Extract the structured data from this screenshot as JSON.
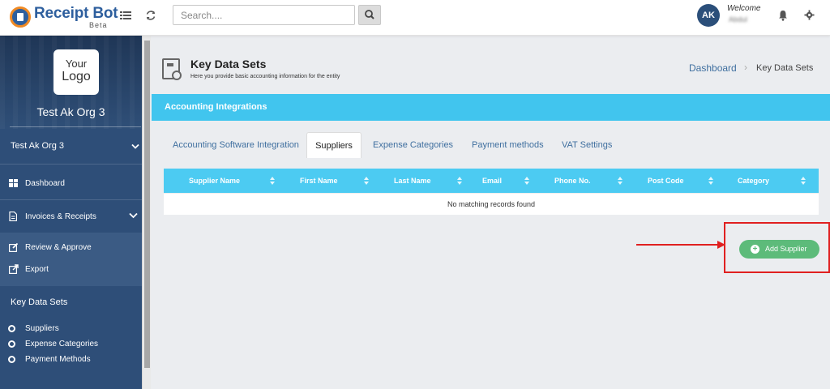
{
  "app": {
    "brand_name": "Receipt Bot",
    "brand_sub": "Beta"
  },
  "header": {
    "search_placeholder": "Search....",
    "avatar_initials": "AK",
    "welcome_label": "Welcome",
    "username": "Abdul"
  },
  "sidebar": {
    "logo_line1": "Your",
    "logo_line2": "Logo",
    "org_title": "Test Ak Org 3",
    "org_selector": "Test Ak Org 3",
    "items": [
      {
        "label": "Dashboard",
        "icon": "dashboard-icon"
      },
      {
        "label": "Invoices & Receipts",
        "icon": "document-icon"
      },
      {
        "label": "Review & Approve",
        "icon": "edit-icon"
      },
      {
        "label": "Export",
        "icon": "export-icon"
      }
    ],
    "section_title": "Key Data Sets",
    "section_items": [
      "Suppliers",
      "Expense Categories",
      "Payment Methods"
    ]
  },
  "page": {
    "title": "Key Data Sets",
    "subtitle": "Here you provide basic accounting information for the entity",
    "breadcrumb": {
      "home": "Dashboard",
      "sep": "›",
      "current": "Key Data Sets"
    }
  },
  "panel": {
    "title": "Accounting Integrations",
    "tabs": [
      {
        "label": "Accounting Software Integration",
        "active": false
      },
      {
        "label": "Suppliers",
        "active": true
      },
      {
        "label": "Expense Categories",
        "active": false
      },
      {
        "label": "Payment methods",
        "active": false
      },
      {
        "label": "VAT Settings",
        "active": false
      }
    ]
  },
  "table": {
    "columns": [
      "Supplier Name",
      "First Name",
      "Last Name",
      "Email",
      "Phone No.",
      "Post Code",
      "Category"
    ],
    "empty_message": "No matching records found"
  },
  "actions": {
    "add_supplier": "Add Supplier"
  },
  "colors": {
    "accent": "#41c5ee",
    "sidebar": "#2e4e78",
    "success": "#5dbb7a",
    "highlight": "#e02020"
  }
}
